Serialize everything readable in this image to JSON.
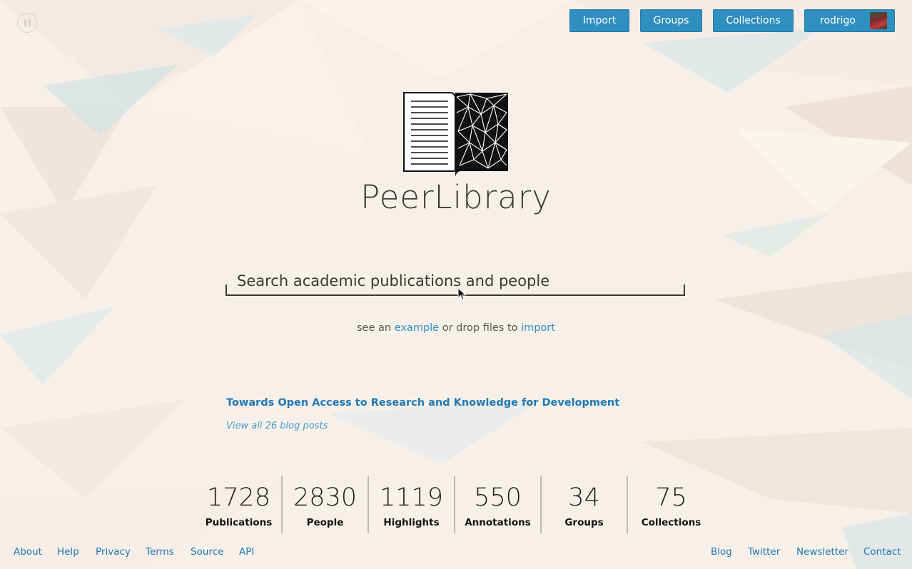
{
  "nav": {
    "import_label": "Import",
    "groups_label": "Groups",
    "collections_label": "Collections",
    "user_label": "rodrigo"
  },
  "brand": {
    "name": "PeerLibrary"
  },
  "search": {
    "placeholder": "Search academic publications and people"
  },
  "hint": {
    "prefix": "see an",
    "example_link": "example",
    "middle": "or drop files to",
    "import_link": "import"
  },
  "blog": {
    "latest_title": "Towards Open Access to Research and Knowledge for Development",
    "view_all": "View all 26 blog posts"
  },
  "stats": [
    {
      "value": "1728",
      "label": "Publications"
    },
    {
      "value": "2830",
      "label": "People"
    },
    {
      "value": "1119",
      "label": "Highlights"
    },
    {
      "value": "550",
      "label": "Annotations"
    },
    {
      "value": "34",
      "label": "Groups"
    },
    {
      "value": "75",
      "label": "Collections"
    }
  ],
  "footer": {
    "left": [
      "About",
      "Help",
      "Privacy",
      "Terms",
      "Source",
      "API"
    ],
    "right": [
      "Blog",
      "Twitter",
      "Newsletter",
      "Contact"
    ]
  },
  "colors": {
    "accent": "#2f8fc0",
    "link": "#1f78b4",
    "background": "#f6efe8"
  },
  "icons": {
    "pause": "pause-icon",
    "logo": "book-logo-icon",
    "avatar": "user-avatar",
    "cursor": "mouse-pointer-icon"
  }
}
